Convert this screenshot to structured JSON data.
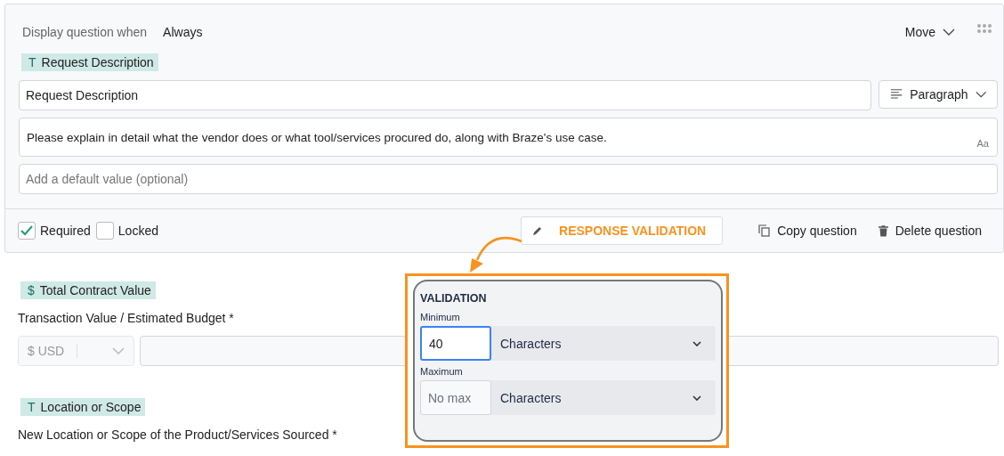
{
  "question": {
    "display_label": "Display question when",
    "display_value": "Always",
    "move_label": "Move",
    "tag": {
      "icon": "T",
      "label": "Request Description"
    },
    "title_value": "Request Description",
    "type_select": "Paragraph",
    "description": "Please explain in detail what the vendor does or what tool/services procured do, along with Braze's use case.",
    "format_hint": "Aa",
    "default_placeholder": "Add a default value (optional)",
    "checkboxes": [
      {
        "label": "Required",
        "checked": true
      },
      {
        "label": "Locked",
        "checked": false
      }
    ],
    "actions": [
      {
        "kind": "validation",
        "label": "RESPONSE VALIDATION"
      },
      {
        "kind": "copy",
        "label": "Copy question"
      },
      {
        "kind": "delete",
        "label": "Delete question"
      }
    ]
  },
  "fields": [
    {
      "tag": {
        "icon": "$",
        "label": "Total Contract Value"
      },
      "label": "Transaction Value / Estimated Budget *",
      "currency": "$ USD"
    },
    {
      "tag": {
        "icon": "T",
        "label": "Location or Scope"
      },
      "label": "New Location or Scope of the Product/Services Sourced *"
    }
  ],
  "validation": {
    "heading": "VALIDATION",
    "rows": [
      {
        "label": "Minimum",
        "value": "40",
        "unit": "Characters",
        "focused": true
      },
      {
        "label": "Maximum",
        "placeholder": "No max",
        "unit": "Characters",
        "focused": false
      }
    ]
  }
}
